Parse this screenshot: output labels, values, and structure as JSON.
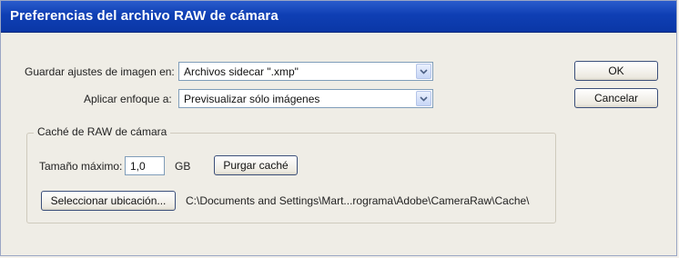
{
  "window": {
    "title": "Preferencias del archivo RAW de cámara"
  },
  "save_settings": {
    "label": "Guardar ajustes de imagen en:",
    "value": "Archivos sidecar \".xmp\""
  },
  "sharpen": {
    "label": "Aplicar enfoque a:",
    "value": "Previsualizar sólo imágenes"
  },
  "cache": {
    "group_label": "Caché de RAW de cámara",
    "max_size_label": "Tamaño máximo:",
    "max_size_value": "1,0",
    "unit": "GB",
    "purge_label": "Purgar caché",
    "select_location_label": "Seleccionar ubicación...",
    "path": "C:\\Documents and Settings\\Mart...rograma\\Adobe\\CameraRaw\\Cache\\"
  },
  "buttons": {
    "ok": "OK",
    "cancel": "Cancelar"
  },
  "colors": {
    "titlebar": "#0f3fb4",
    "title_text": "#ffffff",
    "dialog_bg": "#efede6"
  }
}
